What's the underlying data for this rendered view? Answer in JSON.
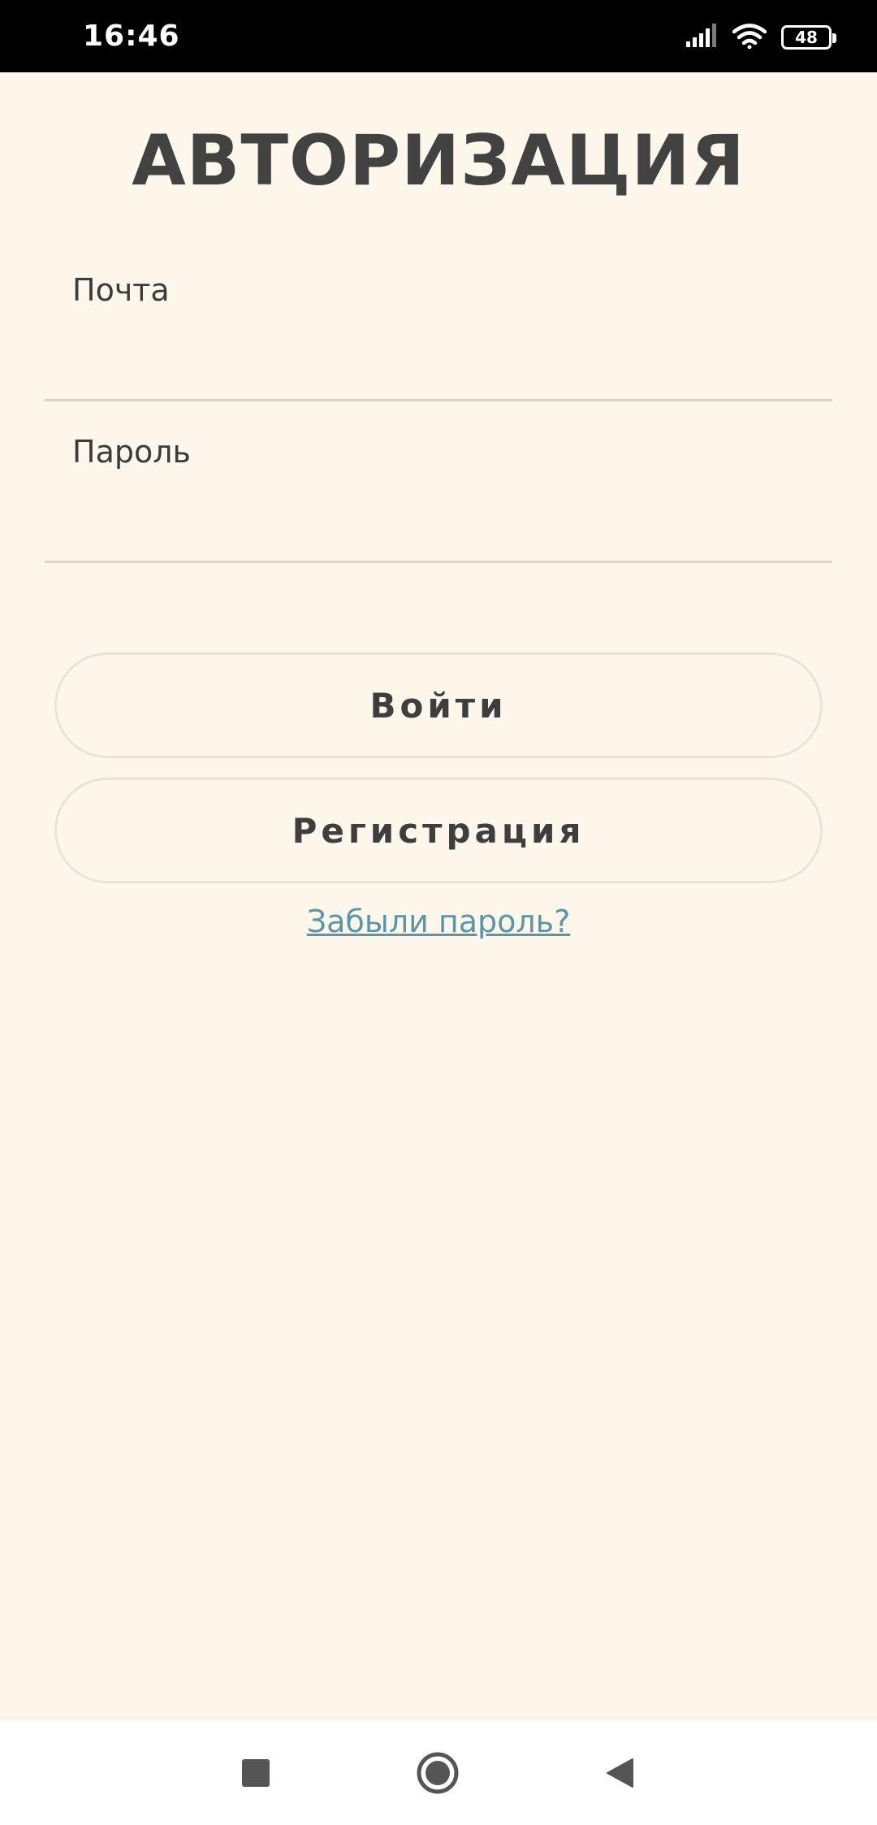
{
  "status_bar": {
    "time": "16:46",
    "battery_level": "48",
    "icons": [
      "signal-icon",
      "wifi-icon",
      "battery-icon"
    ]
  },
  "auth": {
    "title": "АВТОРИЗАЦИЯ",
    "email_label": "Почта",
    "email_value": "",
    "password_label": "Пароль",
    "password_value": "",
    "login_button": "Войти",
    "register_button": "Регистрация",
    "forgot_link": "Забыли пароль?"
  },
  "nav_bar": {
    "icons": [
      "recents-icon",
      "home-icon",
      "back-icon"
    ]
  },
  "colors": {
    "background": "#fdf7eb",
    "text": "#424242",
    "link": "#5b95a8",
    "button_border": "#ebe3d5",
    "field_underline": "#d7d5cd"
  }
}
